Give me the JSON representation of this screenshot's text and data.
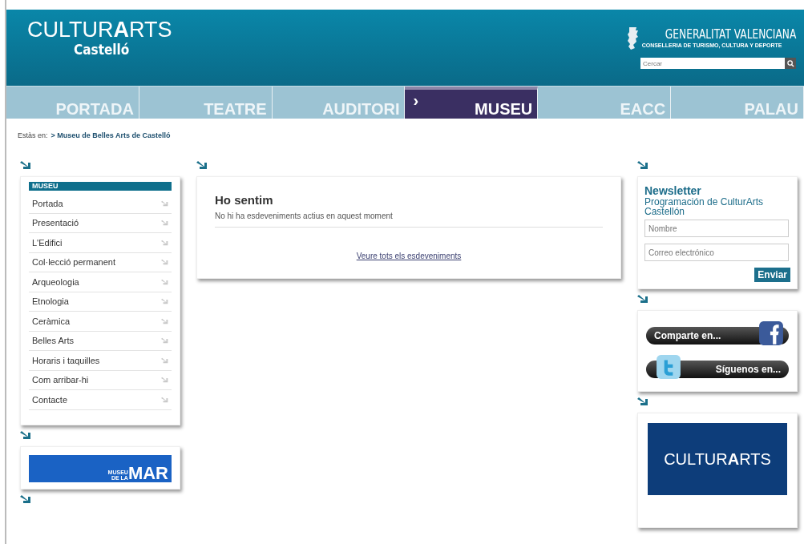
{
  "header": {
    "logo": "CULTUR**A**RTS",
    "logo_sub": "Castelló",
    "gov_title": "GENERALITAT VALENCIANA",
    "gov_subtitle": "CONSELLERIA DE TURISMO, CULTURA Y DEPORTE",
    "search": {
      "placeholder": "Cercar"
    }
  },
  "nav": [
    {
      "label": "PORTADA",
      "selected": false
    },
    {
      "label": "TEATRE",
      "selected": false
    },
    {
      "label": "AUDITORI",
      "selected": false
    },
    {
      "label": "MUSEU",
      "selected": true,
      "marker": "›"
    },
    {
      "label": "EACC",
      "selected": false
    },
    {
      "label": "PALAU",
      "selected": false
    }
  ],
  "breadcrumb": {
    "prefix": "Estàs en:",
    "link": "> Museu de Belles Arts de Castelló"
  },
  "sidebar": {
    "title": "MUSEU",
    "items": [
      "Portada",
      "Presentació",
      "L'Edifici",
      "Col·lecció permanent",
      "Arqueologia",
      "Etnologia",
      "Ceràmica",
      "Belles Arts",
      "Horaris i taquilles",
      "Com arribar-hi",
      "Contacte"
    ],
    "banner": {
      "small_top": "MUSEU",
      "small_bottom": "DE LA",
      "big": "MAR"
    }
  },
  "notice": {
    "title": "Ho sentim",
    "message": "No hi ha esdeveniments actius en aquest moment",
    "link": "Veure tots els esdeveniments"
  },
  "newsletter": {
    "title": "Newsletter",
    "subtitle": "Programación de CulturArts Castellón",
    "fields": [
      {
        "placeholder": "Nombre"
      },
      {
        "placeholder": "Correo electrónico"
      }
    ],
    "button": "Enviar"
  },
  "social": [
    {
      "kind": "facebook",
      "label": "Comparte en..."
    },
    {
      "kind": "twitter",
      "label": "Síguenos en..."
    }
  ],
  "promo": {
    "logo": "CULTUR**A**RTS"
  }
}
